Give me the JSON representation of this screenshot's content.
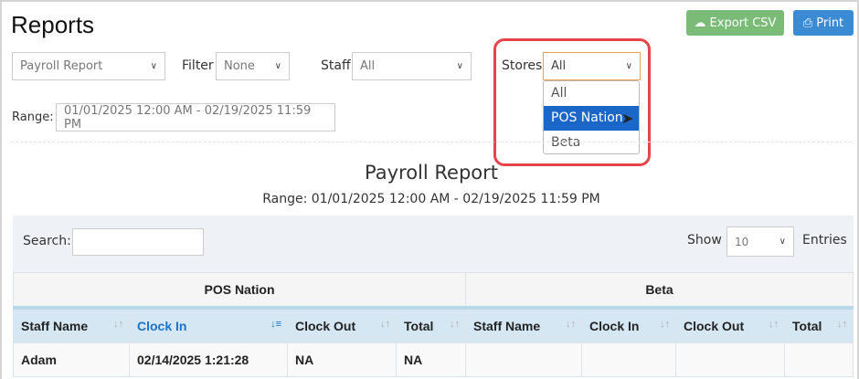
{
  "page": {
    "title": "Reports"
  },
  "toolbar": {
    "export_label": "Export CSV",
    "print_label": "Print",
    "export_color": "#7bbb78",
    "print_color": "#3a8ad4"
  },
  "filters": {
    "report_type": "Payroll Report",
    "filter_label": "Filter",
    "filter_value": "None",
    "staff_label": "Staff",
    "staff_value": "All",
    "stores_label": "Stores",
    "stores_value": "All",
    "stores_options": [
      "All",
      "POS Nation",
      "Beta"
    ],
    "stores_highlighted": "POS Nation",
    "range_label": "Range:",
    "range_value": "01/01/2025 12:00 AM - 02/19/2025 11:59 PM"
  },
  "report": {
    "title": "Payroll Report",
    "range": "Range: 01/01/2025 12:00 AM - 02/19/2025 11:59 PM"
  },
  "table_controls": {
    "search_label": "Search:",
    "search_value": "",
    "show_label": "Show",
    "show_value": "10",
    "entries_label": "Entries"
  },
  "table": {
    "groups": [
      "POS Nation",
      "Beta"
    ],
    "columns": [
      "Staff Name",
      "Clock In",
      "Clock Out",
      "Total",
      "Staff Name",
      "Clock In",
      "Clock Out",
      "Total"
    ],
    "sorted_column": "Clock In",
    "rows": [
      [
        "Adam",
        "02/14/2025 1:21:28",
        "NA",
        "NA",
        "",
        "",
        "",
        ""
      ]
    ]
  }
}
